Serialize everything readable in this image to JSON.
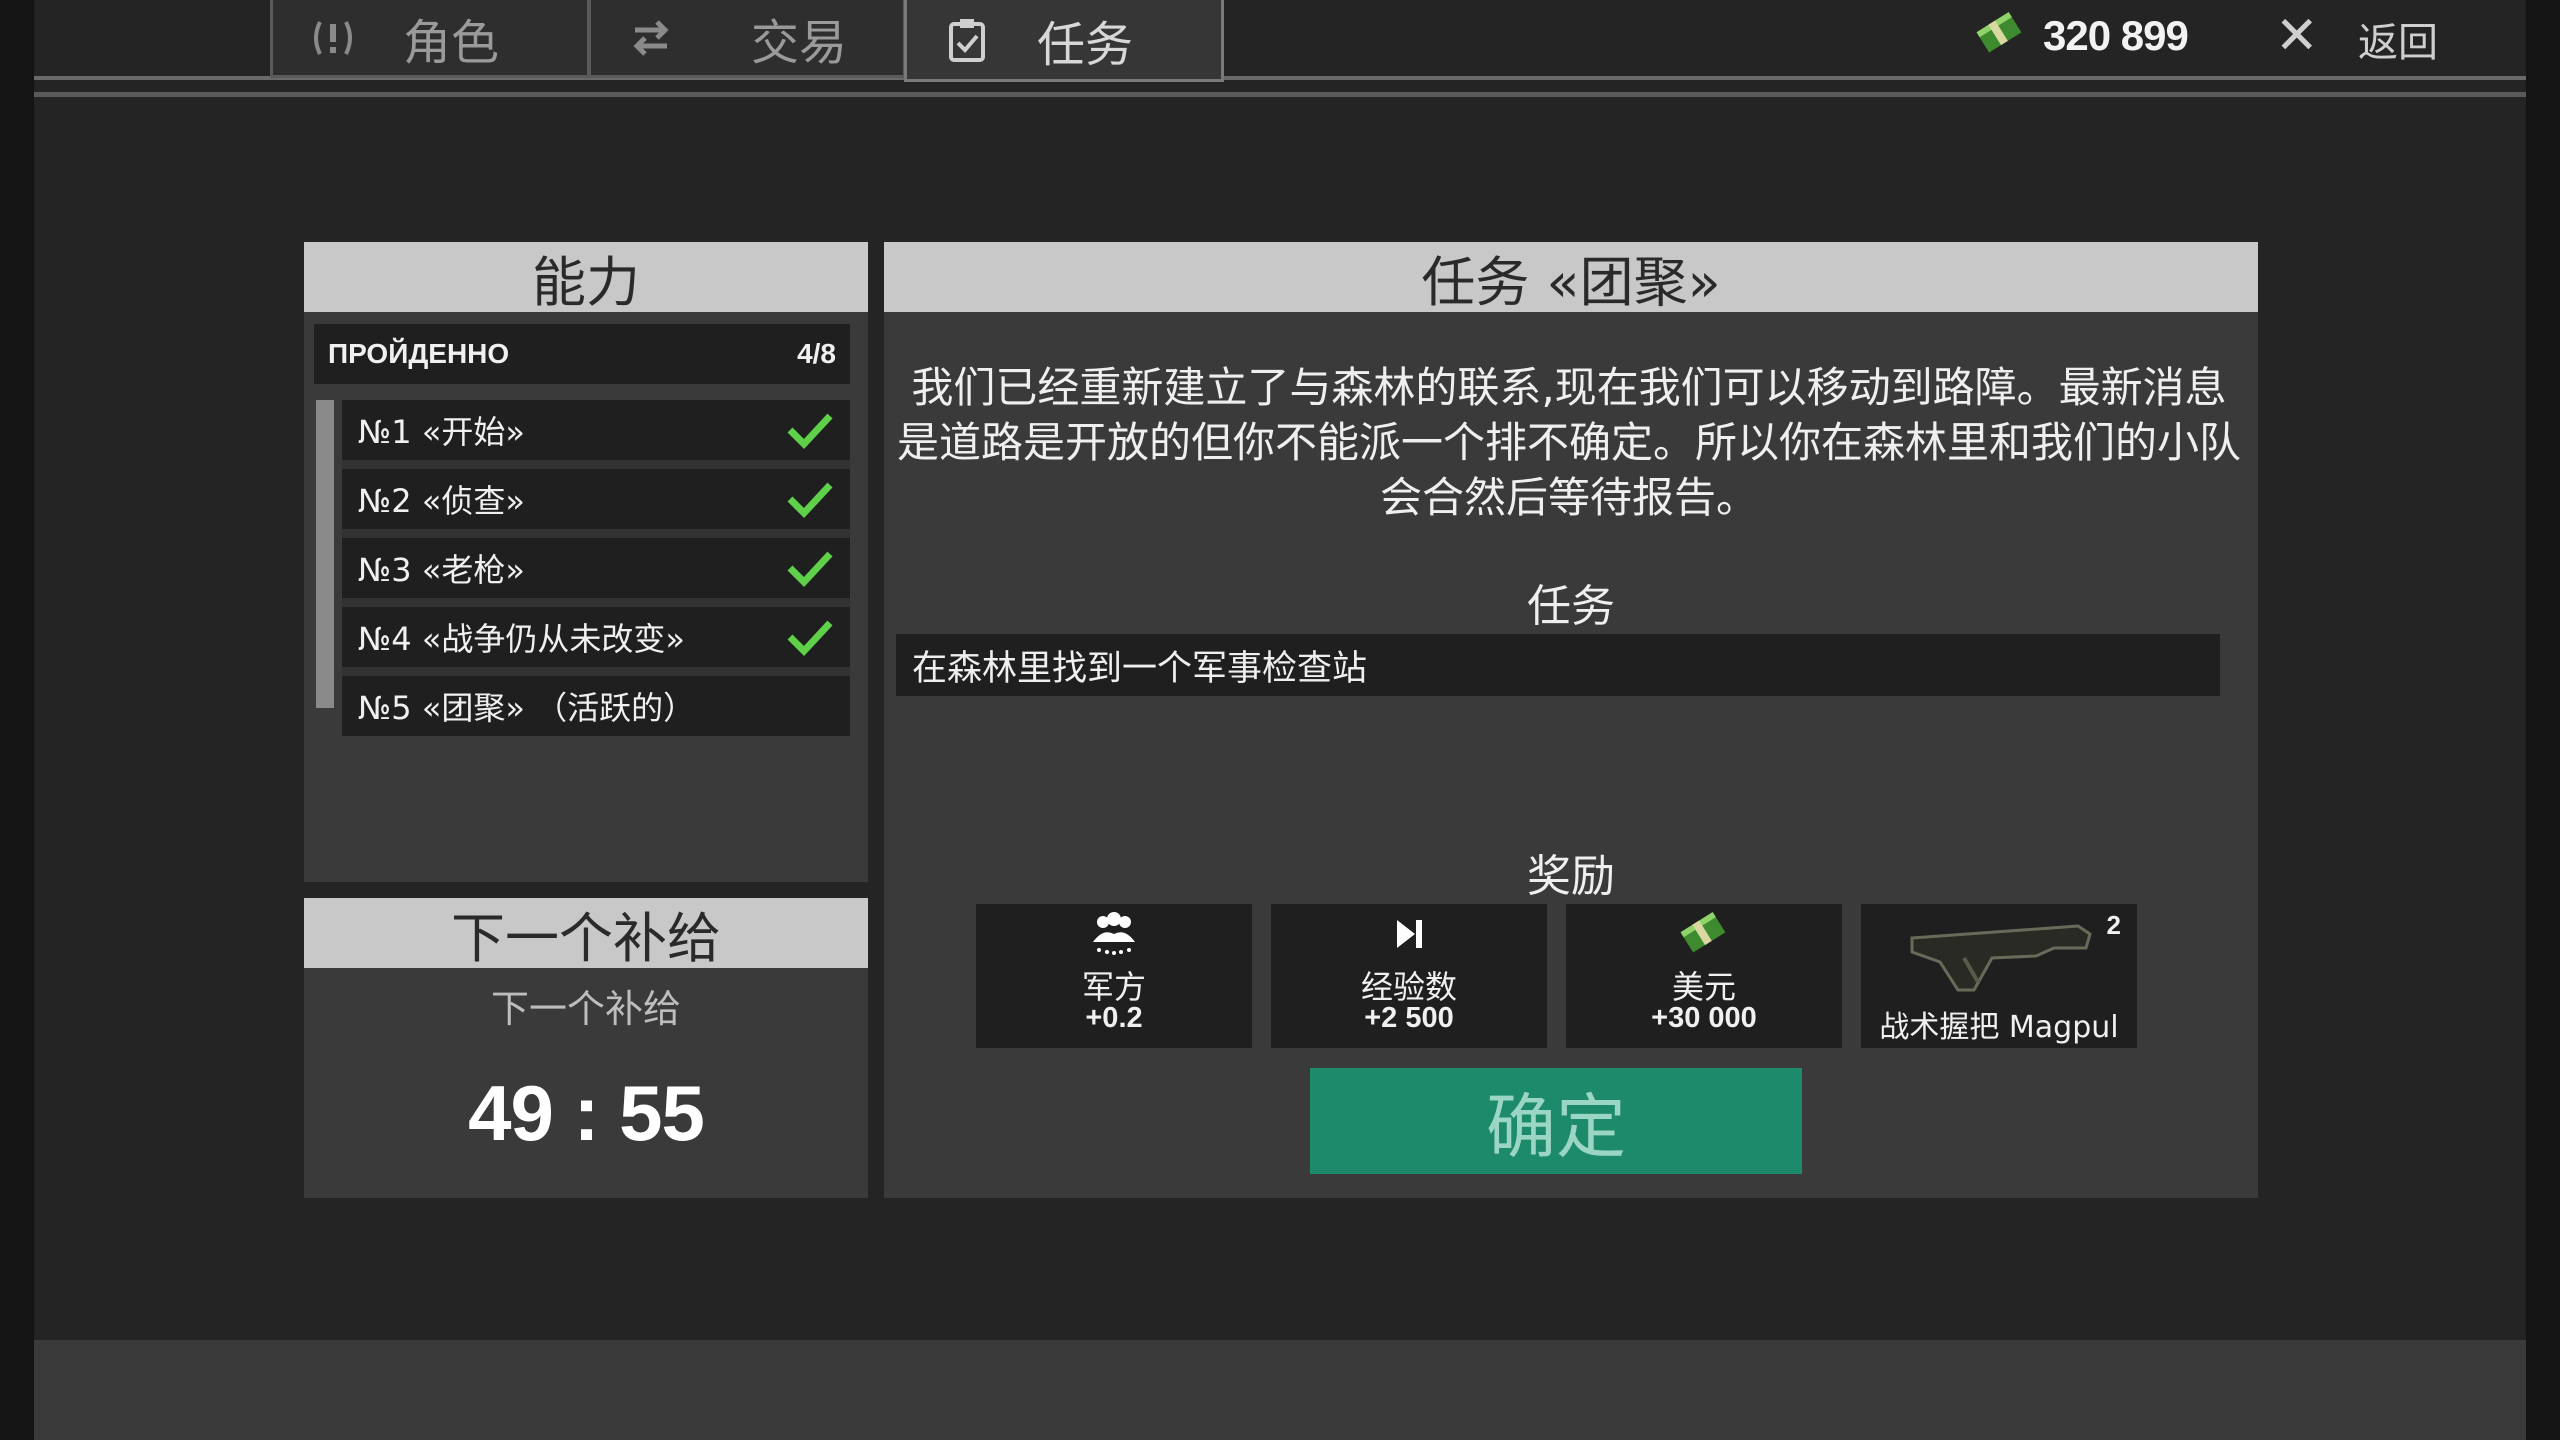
{
  "tabs": [
    {
      "label": "角色",
      "icon": "alert-circle-icon"
    },
    {
      "label": "交易",
      "icon": "swap-arrows-icon"
    },
    {
      "label": "任务",
      "icon": "clipboard-check-icon",
      "active": true
    }
  ],
  "header": {
    "money": "320 899",
    "close": "✕",
    "back": "返回"
  },
  "ability_panel": {
    "title": "能力",
    "passed_label": "ПРОЙДЕННО",
    "passed_count": "4/8",
    "missions": [
      {
        "label": "№1 «开始»",
        "completed": true
      },
      {
        "label": "№2 «侦查»",
        "completed": true
      },
      {
        "label": "№3 «老枪»",
        "completed": true
      },
      {
        "label": "№4 «战争仍从未改变»",
        "completed": true
      },
      {
        "label": "№5 «团聚» （活跃的）",
        "completed": false
      }
    ]
  },
  "supply_panel": {
    "title": "下一个补给",
    "subtitle": "下一个补给",
    "timer": "49 : 55"
  },
  "mission_panel": {
    "title": "任务 «团聚»",
    "description": "我们已经重新建立了与森林的联系,现在我们可以移动到路障。最新消息是道路是开放的但你不能派一个排不确定。所以你在森林里和我们的小队会合然后等待报告。",
    "objective_title": "任务",
    "objective": "在森林里找到一个军事检查站",
    "rewards_title": "奖励",
    "rewards": [
      {
        "label": "军方",
        "value": "+0.2",
        "icon": "soldiers-icon"
      },
      {
        "label": "经验数",
        "value": "+2 500",
        "icon": "skip-forward-icon"
      },
      {
        "label": "美元",
        "value": "+30 000",
        "icon": "cash-icon"
      },
      {
        "label": "战术握把 Magpul",
        "value": "",
        "count": "2",
        "icon": "tactical-grip-icon"
      }
    ],
    "confirm": "确定"
  },
  "colors": {
    "accent_green": "#1e8a6c",
    "check_green": "#5fd04a",
    "header_gray": "#c8c8c8"
  }
}
